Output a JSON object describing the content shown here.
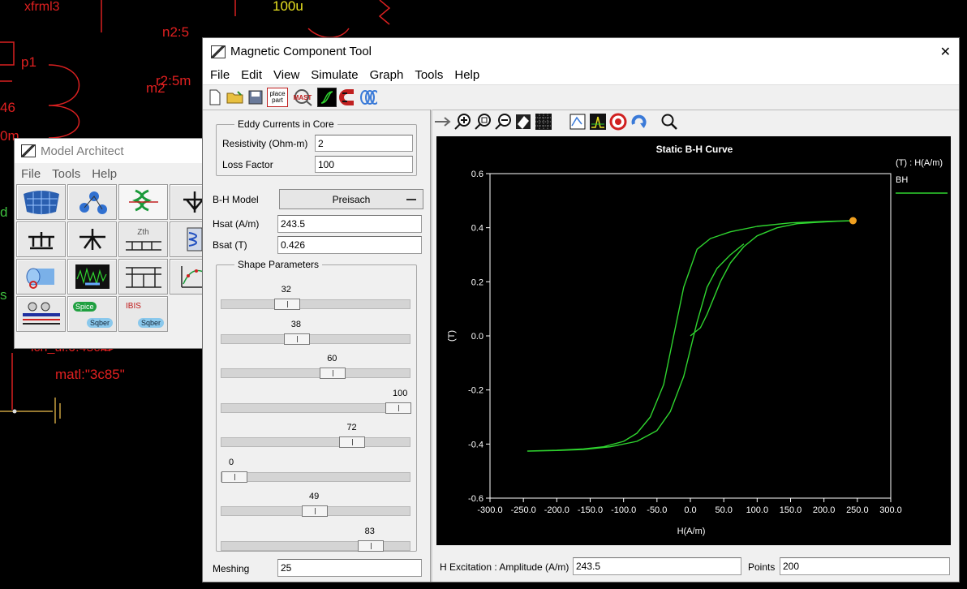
{
  "schematic": {
    "labels": [
      "xfrml3",
      "100u",
      "n2:5",
      "p1",
      "r2:5m",
      "46",
      "m2",
      "0m",
      "d",
      "s",
      "ich_ul:0.45cm",
      "matl:\"3c85\""
    ]
  },
  "model_architect": {
    "title": "Model Architect",
    "menu": [
      "File",
      "Tools",
      "Help"
    ],
    "tile_texts": {
      "zth": "Zth",
      "spice": "Spice",
      "sqber": "Sqber",
      "ibis": "IBIS",
      "sqber2": "Sqber"
    }
  },
  "mct": {
    "title": "Magnetic Component Tool",
    "close_glyph": "✕",
    "menu": [
      "File",
      "Edit",
      "View",
      "Simulate",
      "Graph",
      "Tools",
      "Help"
    ],
    "toolbar_place_part": "place part",
    "toolbar_mast": "MAST",
    "eddy": {
      "title": "Eddy Currents in Core",
      "resistivity_label": "Resistivity (Ohm-m)",
      "resistivity_value": "2",
      "loss_label": "Loss Factor",
      "loss_value": "100"
    },
    "bh_model_label": "B-H Model",
    "bh_model_value": "Preisach",
    "hsat_label": "Hsat (A/m)",
    "hsat_value": "243.5",
    "bsat_label": "Bsat (T)",
    "bsat_value": "0.426",
    "shape_title": "Shape Parameters",
    "sliders": [
      {
        "label": "32",
        "value": 32
      },
      {
        "label": "38",
        "value": 38
      },
      {
        "label": "60",
        "value": 60
      },
      {
        "label": "100",
        "value": 100
      },
      {
        "label": "72",
        "value": 72
      },
      {
        "label": "0",
        "value": 0
      },
      {
        "label": "49",
        "value": 49
      },
      {
        "label": "83",
        "value": 83
      }
    ],
    "meshing_label": "Meshing",
    "meshing_value": "25",
    "excitation_label": "H Excitation : Amplitude (A/m)",
    "excitation_value": "243.5",
    "points_label": "Points",
    "points_value": "200"
  },
  "chart_data": {
    "type": "line",
    "title": "Static B-H Curve",
    "xlabel": "H(A/m)",
    "ylabel": "(T)",
    "legend_header": "(T) : H(A/m)",
    "legend_position": "right",
    "xlim": [
      -300,
      300
    ],
    "ylim": [
      -0.6,
      0.6
    ],
    "x_ticks": [
      "-300.0",
      "-250.0",
      "-200.0",
      "-150.0",
      "-100.0",
      "-50.0",
      "0.0",
      "50.0",
      "100.0",
      "150.0",
      "200.0",
      "250.0",
      "300.0"
    ],
    "y_ticks": [
      "0.6",
      "0.4",
      "0.2",
      "0.0",
      "-0.2",
      "-0.4",
      "-0.6"
    ],
    "series": [
      {
        "name": "BH",
        "color": "#2fd42f",
        "x": [
          0,
          15,
          25,
          35,
          45,
          60,
          80,
          100,
          130,
          160,
          190,
          220,
          243.5,
          200,
          150,
          100,
          60,
          30,
          10,
          -10,
          -25,
          -40,
          -60,
          -80,
          -100,
          -130,
          -160,
          -200,
          -243.5,
          -200,
          -160,
          -120,
          -80,
          -50,
          -30,
          -10,
          10,
          25,
          40,
          60,
          80
        ],
        "y": [
          0,
          0.03,
          0.08,
          0.14,
          0.2,
          0.27,
          0.33,
          0.37,
          0.4,
          0.415,
          0.42,
          0.424,
          0.426,
          0.423,
          0.418,
          0.405,
          0.385,
          0.36,
          0.32,
          0.18,
          0.0,
          -0.18,
          -0.3,
          -0.36,
          -0.39,
          -0.41,
          -0.418,
          -0.423,
          -0.426,
          -0.424,
          -0.42,
          -0.41,
          -0.39,
          -0.35,
          -0.28,
          -0.15,
          0.05,
          0.18,
          0.25,
          0.3,
          0.34
        ],
        "end_marker_color": "#f0a020"
      }
    ]
  }
}
